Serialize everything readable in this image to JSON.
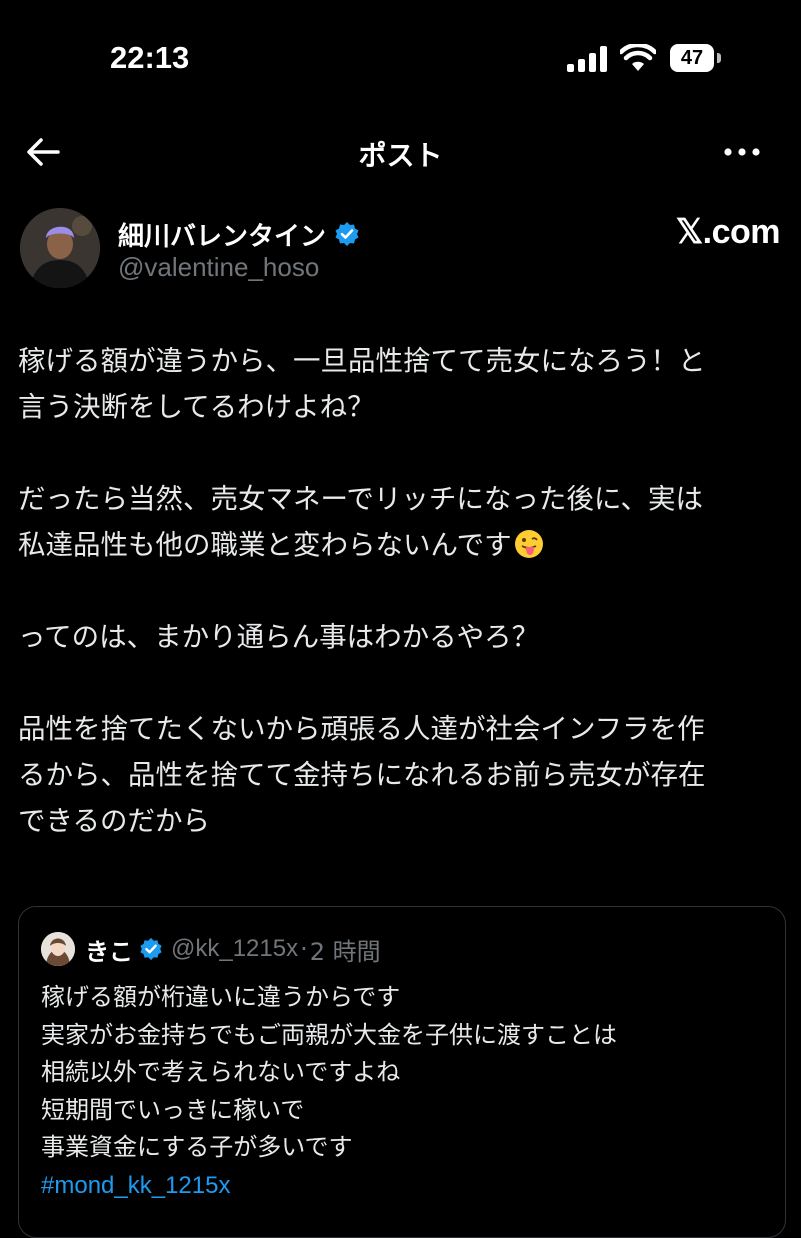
{
  "status_bar": {
    "time": "22:13",
    "battery": "47"
  },
  "nav": {
    "title": "ポスト"
  },
  "post": {
    "display_name": "細川バレンタイン",
    "handle": "@valentine_hoso",
    "watermark": "𝕏.com",
    "paragraphs": [
      {
        "lines": [
          "稼げる額が違うから、一旦品性捨てて売女になろう！と",
          "言う決断をしてるわけよね？"
        ]
      },
      {
        "lines": [
          "だったら当然、売女マネーでリッチになった後に、実は",
          "私達品性も他の職業と変わらないんです"
        ],
        "emoji": "😛"
      },
      {
        "lines": [
          "ってのは、まかり通らん事はわかるやろ？"
        ]
      },
      {
        "lines": [
          "品性を捨てたくないから頑張る人達が社会インフラを作",
          "るから、品性を捨てて金持ちになれるお前ら売女が存在",
          "できるのだから"
        ]
      }
    ]
  },
  "quote": {
    "display_name": "きこ",
    "handle": "@kk_1215x",
    "separator": "·",
    "time": "2 時間",
    "lines": [
      "稼げる額が桁違いに違うからです",
      "実家がお金持ちでもご両親が大金を子供に渡すことは",
      "相続以外で考えられないですよね",
      "短期間でいっきに稼いで",
      "事業資金にする子が多いです"
    ],
    "hashtag": "#mond_kk_1215x"
  },
  "colors": {
    "background": "#000000",
    "text": "#e7e9ea",
    "muted": "#71767b",
    "accent": "#1d9bf0",
    "border": "#2f3336"
  },
  "icons": [
    "signal-icon",
    "wifi-icon",
    "battery-icon",
    "back-arrow-icon",
    "more-icon",
    "verified-icon",
    "emoji-icon"
  ]
}
